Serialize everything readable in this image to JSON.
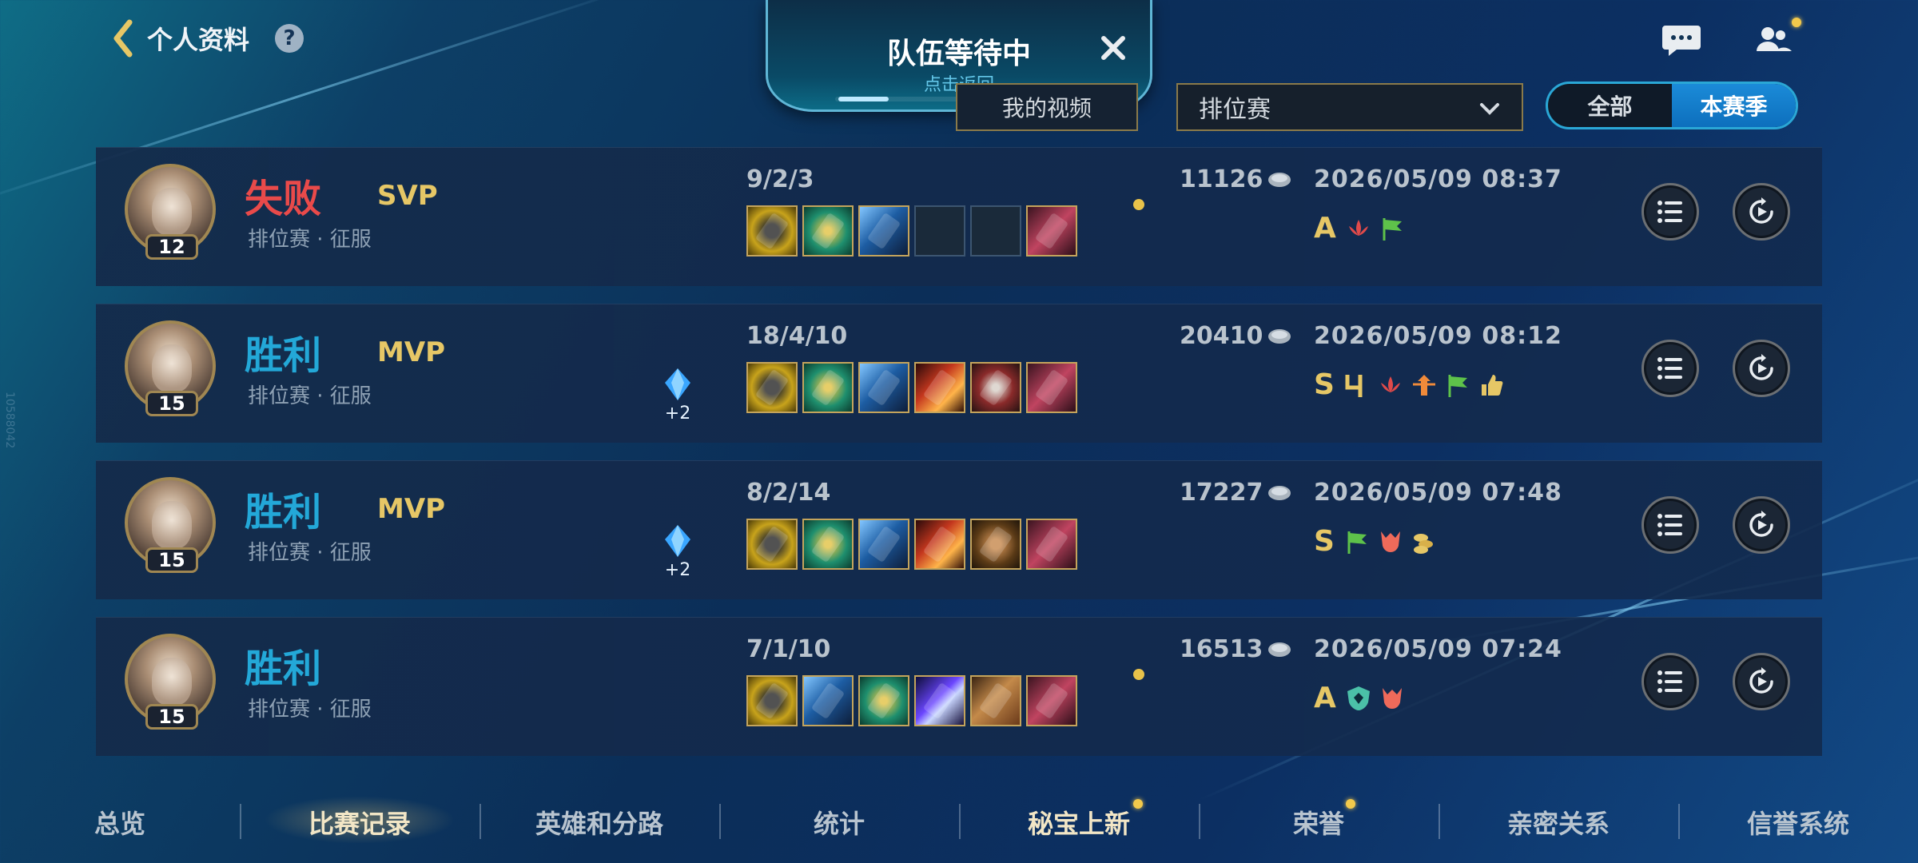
{
  "header": {
    "back_label": "个人资料",
    "help_label": "?",
    "queue": {
      "title": "队伍等待中",
      "subtitle": "点击返回",
      "progress": 0.2
    }
  },
  "filters": {
    "video_label": "我的视频",
    "mode_selected": "排位赛",
    "season_options": [
      "全部",
      "本赛季"
    ],
    "season_selected": "本赛季"
  },
  "matches": [
    {
      "level": "12",
      "result": "失败",
      "result_type": "lose",
      "honor": "SVP",
      "mode": "排位赛 · 征服",
      "gem": "",
      "kda": "9/2/3",
      "gold": "11126",
      "datetime": "2026/05/09 08:37",
      "grade": "A"
    },
    {
      "level": "15",
      "result": "胜利",
      "result_type": "win",
      "honor": "MVP",
      "mode": "排位赛 · 征服",
      "gem": "+2",
      "kda": "18/4/10",
      "gold": "20410",
      "datetime": "2026/05/09 08:12",
      "grade": "S"
    },
    {
      "level": "15",
      "result": "胜利",
      "result_type": "win",
      "honor": "MVP",
      "mode": "排位赛 · 征服",
      "gem": "+2",
      "kda": "8/2/14",
      "gold": "17227",
      "datetime": "2026/05/09 07:48",
      "grade": "S"
    },
    {
      "level": "15",
      "result": "胜利",
      "result_type": "win",
      "honor": "",
      "mode": "排位赛 · 征服",
      "gem": "",
      "kda": "7/1/10",
      "gold": "16513",
      "datetime": "2026/05/09 07:24",
      "grade": "A"
    }
  ],
  "nav": [
    {
      "label": "总览",
      "state": "normal"
    },
    {
      "label": "比赛记录",
      "state": "active"
    },
    {
      "label": "英雄和分路",
      "state": "normal"
    },
    {
      "label": "统计",
      "state": "normal"
    },
    {
      "label": "秘宝上新",
      "state": "highlight"
    },
    {
      "label": "荣誉",
      "state": "normal"
    },
    {
      "label": "亲密关系",
      "state": "normal"
    },
    {
      "label": "信誉系统",
      "state": "normal"
    }
  ],
  "side_watermark": "10588042",
  "colors": {
    "win": "#23a8d8",
    "lose": "#e94a4a",
    "gold_text": "#e6c766",
    "accent": "#2aa7d6"
  }
}
